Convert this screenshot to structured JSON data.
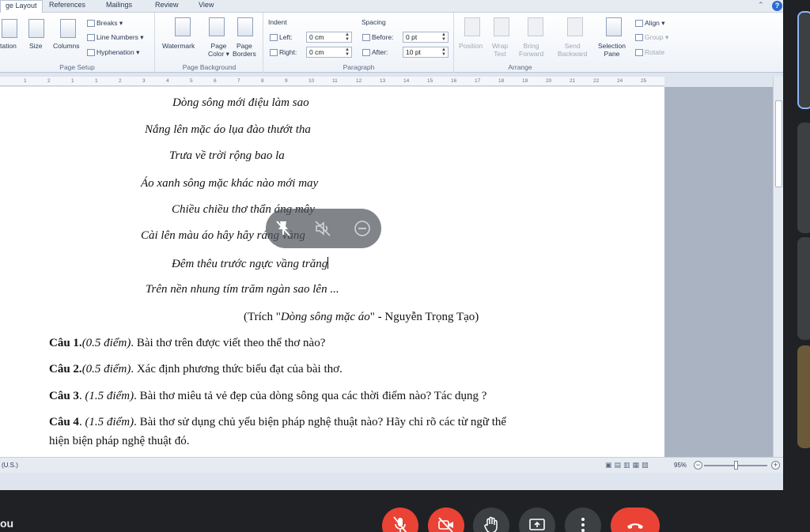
{
  "tabs": {
    "active": "ge Layout",
    "items": [
      "References",
      "Mailings",
      "Review",
      "View"
    ]
  },
  "ribbon": {
    "page_setup": {
      "orientation": "tation",
      "size": "Size",
      "columns": "Columns",
      "breaks": "Breaks",
      "line_numbers": "Line Numbers",
      "hyphenation": "Hyphenation",
      "group_label": "Page Setup"
    },
    "page_background": {
      "watermark": "Watermark",
      "page_color_1": "Page",
      "page_color_2": "Color",
      "page_borders_1": "Page",
      "page_borders_2": "Borders",
      "group_label": "Page Background"
    },
    "paragraph": {
      "indent": "Indent",
      "left": "Left:",
      "left_value": "0 cm",
      "right": "Right:",
      "right_value": "0 cm",
      "spacing": "Spacing",
      "before": "Before:",
      "before_value": "0 pt",
      "after": "After:",
      "after_value": "10 pt",
      "group_label": "Paragraph"
    },
    "arrange": {
      "position": "Position",
      "wrap_1": "Wrap",
      "wrap_2": "Text",
      "bring_1": "Bring",
      "bring_2": "Forward",
      "send_1": "Send",
      "send_2": "Backward",
      "selection_1": "Selection",
      "selection_2": "Pane",
      "align": "Align",
      "group": "Group",
      "rotate": "Rotate",
      "group_label": "Arrange"
    }
  },
  "ruler": [
    "1",
    "2",
    "1",
    "1",
    "2",
    "3",
    "4",
    "5",
    "6",
    "7",
    "8",
    "9",
    "10",
    "11",
    "12",
    "13",
    "14",
    "15",
    "16",
    "17",
    "18",
    "19",
    "20",
    "21",
    "22",
    "24",
    "25"
  ],
  "document": {
    "poem": [
      "Dòng sông mới điệu làm sao",
      "Nắng lên mặc áo lụa đào thướt tha",
      "Trưa về trời rộng bao la",
      "Áo xanh sông mặc khác nào mới may",
      "Chiều chiều thơ thẩn áng mây",
      "Cài lên màu áo hây hây ráng vàng",
      "Đêm thêu trước ngực vầng trăng",
      "Trên nền nhung tím trăm ngàn sao lên ..."
    ],
    "citation": {
      "prefix": "(Trích \"",
      "title": "Dòng sông mặc áo",
      "suffix": "\" - Nguyễn Trọng Tạo)"
    },
    "questions": [
      {
        "label": "Câu 1.",
        "points": "(0.5 điểm)",
        "text": ". Bài thơ trên được viết theo thể thơ nào?"
      },
      {
        "label": "Câu 2.",
        "points": "(0.5 điểm)",
        "text": ". Xác định phương thức biểu đạt của bài thơ."
      },
      {
        "label": "Câu 3",
        "points": "(1.5 điểm)",
        "text": ".  Bài thơ miêu tả vẻ đẹp của dòng sông qua các thời điểm nào? Tác dụng ?"
      },
      {
        "label": "Câu 4",
        "points": "(1.5 điểm)",
        "text": ".  Bài thơ sử dụng chủ yếu biện pháp nghệ thuật nào? Hãy chỉ rõ các từ ngữ thể"
      }
    ],
    "q4_continuation": "hiện biện pháp nghệ thuật đó."
  },
  "statusbar": {
    "language": "(U.S.)",
    "zoom": "95%",
    "zoom_level_percent": 95
  },
  "meeting": {
    "self_name": "ou"
  },
  "colors": {
    "danger": "#ea4335",
    "control_grey": "#3c4043",
    "meeting_bg": "#202124",
    "ribbon_bg": "#eef2f8"
  },
  "icons": {
    "overlay": [
      "pin-off-icon",
      "speaker-muted-icon",
      "remove-icon"
    ],
    "controls": [
      "mic-off-icon",
      "camera-off-icon",
      "raise-hand-icon",
      "present-screen-icon",
      "more-options-icon",
      "end-call-icon"
    ]
  }
}
